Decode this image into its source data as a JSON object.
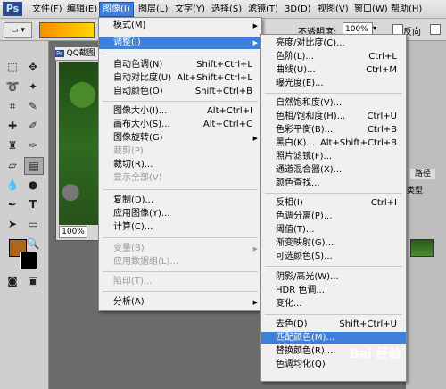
{
  "menubar": {
    "logo": "Ps",
    "items": [
      "文件(F)",
      "编辑(E)",
      "图像(I)",
      "图层(L)",
      "文字(Y)",
      "选择(S)",
      "滤镜(T)",
      "3D(D)",
      "视图(V)",
      "窗口(W)",
      "帮助(H)"
    ]
  },
  "options": {
    "opacity_label": "不透明度:",
    "opacity_value": "100%",
    "reverse_label": "反向"
  },
  "document": {
    "tab_title": "QQ截图",
    "zoom": "100%"
  },
  "panel": {
    "path_tab": "路径",
    "kind_label": "类型"
  },
  "image_menu": {
    "items": [
      {
        "label": "模式(M)",
        "shortcut": "",
        "submenu": true,
        "disabled": false
      },
      {
        "label": "调整(J)",
        "shortcut": "",
        "submenu": true,
        "disabled": false,
        "highlighted": true
      },
      {
        "label": "自动色调(N)",
        "shortcut": "Shift+Ctrl+L",
        "disabled": false
      },
      {
        "label": "自动对比度(U)",
        "shortcut": "Alt+Shift+Ctrl+L",
        "disabled": false
      },
      {
        "label": "自动颜色(O)",
        "shortcut": "Shift+Ctrl+B",
        "disabled": false
      },
      {
        "label": "图像大小(I)...",
        "shortcut": "Alt+Ctrl+I",
        "disabled": false
      },
      {
        "label": "画布大小(S)...",
        "shortcut": "Alt+Ctrl+C",
        "disabled": false
      },
      {
        "label": "图像旋转(G)",
        "shortcut": "",
        "submenu": true,
        "disabled": false
      },
      {
        "label": "裁剪(P)",
        "shortcut": "",
        "disabled": true
      },
      {
        "label": "裁切(R)...",
        "shortcut": "",
        "disabled": false
      },
      {
        "label": "显示全部(V)",
        "shortcut": "",
        "disabled": true
      },
      {
        "label": "复制(D)...",
        "shortcut": "",
        "disabled": false
      },
      {
        "label": "应用图像(Y)...",
        "shortcut": "",
        "disabled": false
      },
      {
        "label": "计算(C)...",
        "shortcut": "",
        "disabled": false
      },
      {
        "label": "变量(B)",
        "shortcut": "",
        "submenu": true,
        "disabled": true
      },
      {
        "label": "应用数据组(L)...",
        "shortcut": "",
        "disabled": true
      },
      {
        "label": "陷印(T)...",
        "shortcut": "",
        "disabled": true
      },
      {
        "label": "分析(A)",
        "shortcut": "",
        "submenu": true,
        "disabled": false
      }
    ]
  },
  "adjust_menu": {
    "items": [
      {
        "label": "亮度/对比度(C)...",
        "shortcut": ""
      },
      {
        "label": "色阶(L)...",
        "shortcut": "Ctrl+L"
      },
      {
        "label": "曲线(U)...",
        "shortcut": "Ctrl+M"
      },
      {
        "label": "曝光度(E)...",
        "shortcut": ""
      },
      {
        "label": "自然饱和度(V)...",
        "shortcut": ""
      },
      {
        "label": "色相/饱和度(H)...",
        "shortcut": "Ctrl+U"
      },
      {
        "label": "色彩平衡(B)...",
        "shortcut": "Ctrl+B"
      },
      {
        "label": "黑白(K)...",
        "shortcut": "Alt+Shift+Ctrl+B"
      },
      {
        "label": "照片滤镜(F)...",
        "shortcut": ""
      },
      {
        "label": "通道混合器(X)...",
        "shortcut": ""
      },
      {
        "label": "颜色查找...",
        "shortcut": ""
      },
      {
        "label": "反相(I)",
        "shortcut": "Ctrl+I"
      },
      {
        "label": "色调分离(P)...",
        "shortcut": ""
      },
      {
        "label": "阈值(T)...",
        "shortcut": ""
      },
      {
        "label": "渐变映射(G)...",
        "shortcut": ""
      },
      {
        "label": "可选颜色(S)...",
        "shortcut": ""
      },
      {
        "label": "阴影/高光(W)...",
        "shortcut": ""
      },
      {
        "label": "HDR 色调...",
        "shortcut": ""
      },
      {
        "label": "变化...",
        "shortcut": ""
      },
      {
        "label": "去色(D)",
        "shortcut": "Shift+Ctrl+U"
      },
      {
        "label": "匹配颜色(M)...",
        "shortcut": "",
        "highlighted": true
      },
      {
        "label": "替换颜色(R)...",
        "shortcut": ""
      },
      {
        "label": "色调均化(Q)",
        "shortcut": ""
      }
    ]
  },
  "watermark": "Bai 经验"
}
